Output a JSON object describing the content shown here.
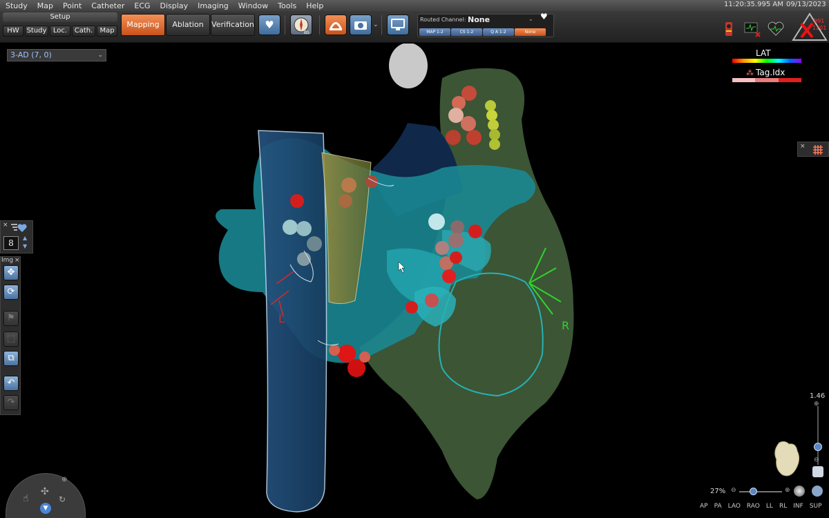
{
  "menu": [
    "Study",
    "Map",
    "Point",
    "Catheter",
    "ECG",
    "Display",
    "Imaging",
    "Window",
    "Tools",
    "Help"
  ],
  "clock": {
    "time": "11:20:35.995 AM",
    "date": "09/13/2023"
  },
  "toolbar": {
    "setup_label": "Setup",
    "setup_buttons": [
      "HW",
      "Study",
      "Loc.",
      "Cath.",
      "Map"
    ],
    "workflow": [
      "Mapping",
      "Ablation",
      "Verification"
    ],
    "workflow_active": "Mapping",
    "routed_channel_label": "Routed Channel:",
    "routed_channel_value": "None",
    "channels": [
      "MAP 1-2",
      "CS 1-2",
      "Q A 1-2",
      "None"
    ],
    "channel_selected": "None",
    "compass_badge": "BS",
    "status_numbers": [
      "991",
      "1201"
    ]
  },
  "viewport": {
    "map_name": "3-AD (7, 0)",
    "labels": {
      "left": "L",
      "right": "R"
    },
    "counter_value": "8",
    "img_panel_label": "Img"
  },
  "legend": {
    "lat_label": "LAT",
    "tag_label": "Tag.Idx",
    "tag_colors": [
      "#f7c0c0",
      "#e97c7c",
      "#e02020"
    ]
  },
  "zoom": {
    "scale": "1.46",
    "percent": "27%"
  },
  "views": [
    "AP",
    "PA",
    "LAO",
    "RAO",
    "LL",
    "RL",
    "INF",
    "SUP"
  ],
  "colors": {
    "accent": "#e06a2c",
    "blue_button": "#4a73a0",
    "tissue": "#4a6340",
    "chamber": "#1a8a95"
  }
}
